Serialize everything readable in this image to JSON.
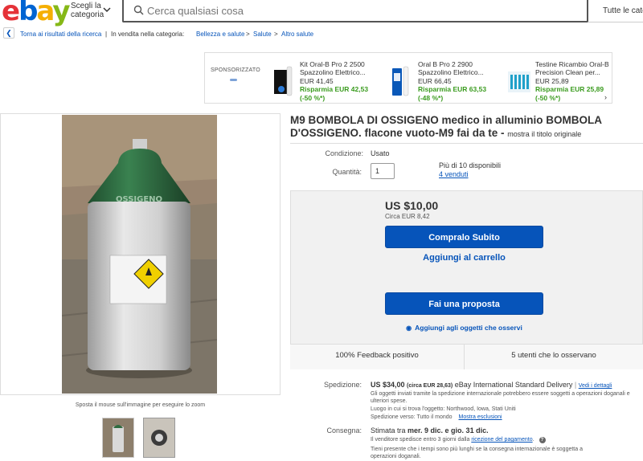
{
  "header": {
    "logo_letters": [
      "e",
      "b",
      "a",
      "y"
    ],
    "logo_colors": [
      "#e53238",
      "#0064d2",
      "#f5af02",
      "#86b817"
    ],
    "category_label_1": "Scegli la",
    "category_label_2": "categoria",
    "search_placeholder": "Cerca qualsiasi cosa",
    "all_categories": "Tutte le categorie"
  },
  "breadcrumb": {
    "back": "Torna ai risultati della ricerca",
    "sep": "|",
    "listed_in": "In vendita nella categoria:",
    "items": [
      "Bellezza e salute",
      "Salute",
      "Altro salute"
    ],
    "arrow": ">"
  },
  "sponsored": {
    "label": "SPONSORIZZATO",
    "ads": [
      {
        "title1": "Kit Oral-B Pro 2 2500",
        "title2": "Spazzolino Elettrico...",
        "price": "EUR 41,45",
        "savings": "Risparmia EUR 42,53",
        "discount": "(-50 %*)"
      },
      {
        "title1": "Oral B Pro 2 2900",
        "title2": "Spazzolino Elettrico...",
        "price": "EUR 66,45",
        "savings": "Risparmia EUR 63,53",
        "discount": "(-48 %*)"
      },
      {
        "title1": "Testine Ricambio Oral-B",
        "title2": "Precision Clean per...",
        "price": "EUR 25,89",
        "savings": "Risparmia EUR 25,89",
        "discount": "(-50 %*)"
      }
    ]
  },
  "gallery": {
    "hover_note": "Sposta il mouse sull'immagine per eseguire lo zoom",
    "cylinder_label": "OSSIGENO"
  },
  "item": {
    "title": "M9 BOMBOLA DI OSSIGENO medico in alluminio BOMBOLA D'OSSIGENO. flacone vuoto-M9 fai da te -",
    "show_original": "mostra il titolo originale",
    "condition_label": "Condizione:",
    "condition_value": "Usato",
    "quantity_label": "Quantità:",
    "quantity_value": "1",
    "available": "Più di 10 disponibili",
    "sold": "4 venduti",
    "price": "US $10,00",
    "price_converted": "Circa EUR 8,42",
    "buy_now": "Compralo Subito",
    "add_to_cart": "Aggiungi al carrello",
    "make_offer": "Fai una proposta",
    "add_watch": "Aggiungi agli oggetti che osservi",
    "feedback": "100% Feedback positivo",
    "watchers": "5 utenti che lo osservano"
  },
  "shipping": {
    "label": "Spedizione:",
    "price": "US $34,00",
    "price_converted": "(circa EUR 28,63)",
    "service": "eBay International Standard Delivery",
    "sep": "|",
    "details_link": "Vedi i dettagli",
    "note1": "Gli oggetti inviati tramite la spedizione internazionale potrebbero essere soggetti a operazioni doganali e",
    "note2": "ulteriori spese.",
    "location": "Luogo in cui si trova l'oggetto: Northwood, Iowa, Stati Uniti",
    "ships_to": "Spedizione verso: Tutto il mondo",
    "exclusions": "Mostra esclusioni"
  },
  "delivery": {
    "label": "Consegna:",
    "estimate": "Stimata tra",
    "dates": "mer. 9 dic. e gio. 31 dic.",
    "note_pre": "Il venditore spedisce entro 3 giorni dalla",
    "note_link": "ricezione del pagamento",
    "note_post": ".",
    "note2": "Tieni presente che i tempi sono più lunghi se la consegna internazionale è soggetta a",
    "note3": "operazioni doganali."
  }
}
